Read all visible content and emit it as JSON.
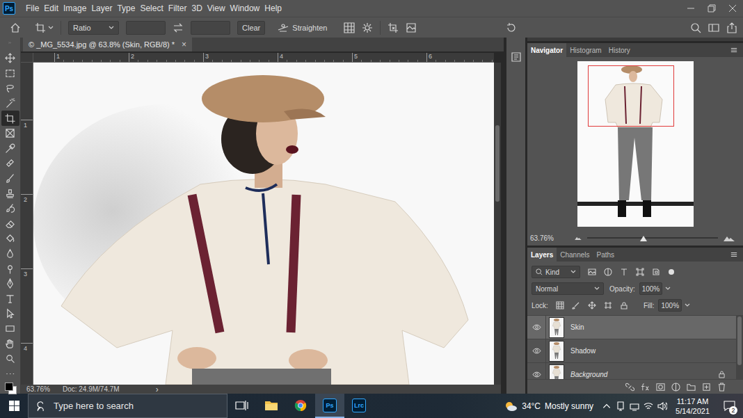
{
  "app": {
    "logo": "Ps"
  },
  "menu": [
    "File",
    "Edit",
    "Image",
    "Layer",
    "Type",
    "Select",
    "Filter",
    "3D",
    "View",
    "Window",
    "Help"
  ],
  "options_bar": {
    "ratio": "Ratio",
    "clear": "Clear",
    "straighten": "Straighten"
  },
  "tools": [
    {
      "selected": false
    },
    {
      "selected": false
    },
    {
      "selected": false
    },
    {
      "selected": false
    },
    {
      "selected": true
    },
    {
      "selected": false
    },
    {
      "selected": false
    },
    {
      "selected": false
    },
    {
      "selected": false
    },
    {
      "selected": false
    },
    {
      "selected": false
    },
    {
      "selected": false
    },
    {
      "selected": false
    },
    {
      "selected": false
    },
    {
      "selected": false
    },
    {
      "selected": false
    },
    {
      "selected": false
    },
    {
      "selected": false
    },
    {
      "selected": false
    },
    {
      "selected": false
    },
    {
      "selected": false
    },
    {
      "selected": false
    }
  ],
  "document": {
    "title": "© _MG_5534.jpg @ 63.8% (Skin, RGB/8) *",
    "close": "×",
    "ruler_top": [
      "1",
      "2",
      "3",
      "4",
      "5",
      "6"
    ],
    "ruler_left": [
      "1",
      "2",
      "3",
      "4"
    ]
  },
  "status_bar": {
    "zoom": "63.76%",
    "doc": "Doc: 24.9M/74.7M",
    "more": "›"
  },
  "navigator": {
    "tabs": [
      {
        "label": "Navigator",
        "selected": true
      },
      {
        "label": "Histogram",
        "selected": false
      },
      {
        "label": "History",
        "selected": false
      }
    ],
    "zoom": "63.76%",
    "level": 0.43
  },
  "layers_panel": {
    "tabs": [
      {
        "label": "Layers",
        "selected": true
      },
      {
        "label": "Channels",
        "selected": false
      },
      {
        "label": "Paths",
        "selected": false
      }
    ],
    "filter": "Kind",
    "blend": "Normal",
    "opacity_label": "Opacity:",
    "opacity": "100%",
    "lock_label": "Lock:",
    "fill_label": "Fill:",
    "fill": "100%",
    "layers": [
      {
        "name": "Skin",
        "selected": true,
        "visible": true,
        "locked": false
      },
      {
        "name": "Shadow",
        "selected": false,
        "visible": true,
        "locked": false
      },
      {
        "name": "Background",
        "selected": false,
        "visible": true,
        "locked": true
      }
    ]
  },
  "taskbar": {
    "search": "Type here to search",
    "apps": [
      {
        "selected": false
      },
      {
        "selected": false
      },
      {
        "selected": false
      },
      {
        "label": "Ps",
        "selected": true
      },
      {
        "label": "Lrc",
        "selected": false
      }
    ],
    "weather": {
      "temp": "34°C",
      "text": "Mostly sunny"
    },
    "clock": {
      "time": "11:17 AM",
      "date": "5/14/2021"
    },
    "notifications": "2"
  }
}
